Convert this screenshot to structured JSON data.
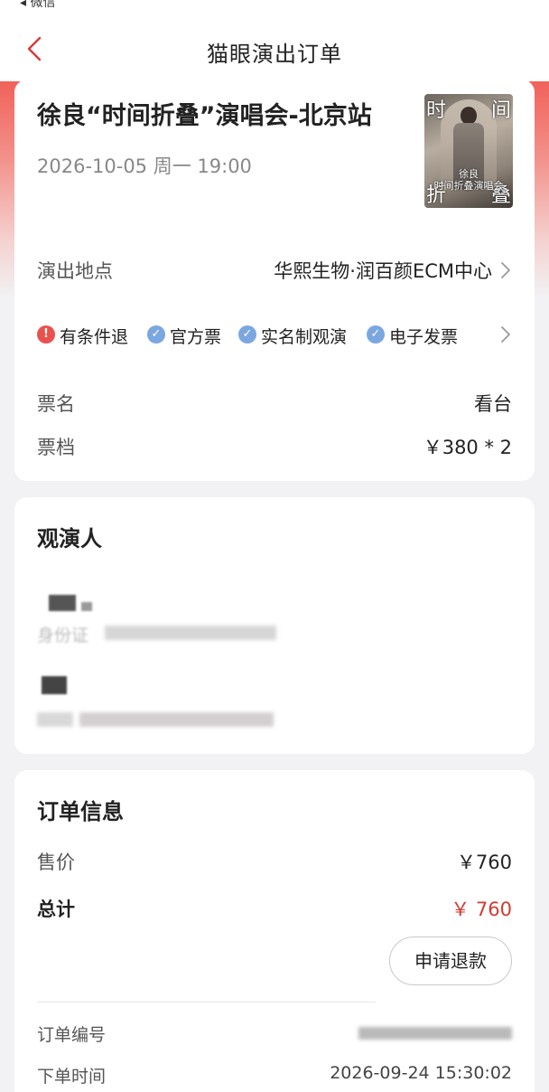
{
  "status_bar": {
    "text": "◂ 微信"
  },
  "nav": {
    "title": "猫眼演出订单"
  },
  "show": {
    "title": "徐良“时间折叠”演唱会-北京站",
    "datetime": "2026-10-05 周一 19:00",
    "poster": {
      "tl": "时",
      "tr": "间",
      "bl": "折",
      "br": "叠",
      "mid_line1": "徐良",
      "mid_line2": "时间折叠演唱会"
    },
    "venue_label": "演出地点",
    "venue_value": "华熙生物·润百颜ECM中心",
    "tags": [
      {
        "icon": "warning-icon",
        "label": "有条件退"
      },
      {
        "icon": "check-icon",
        "label": "官方票"
      },
      {
        "icon": "check-icon",
        "label": "实名制观演"
      },
      {
        "icon": "check-icon",
        "label": "电子发票"
      }
    ],
    "ticket_name_label": "票名",
    "ticket_name_value": "看台",
    "ticket_tier_label": "票档",
    "ticket_tier_value": "￥380 * 2"
  },
  "attendees": {
    "title": "观演人",
    "id_label": "身份证"
  },
  "order": {
    "title": "订单信息",
    "price_label": "售价",
    "price_value": "￥760",
    "total_label": "总计",
    "total_value": "￥ 760",
    "refund_button": "申请退款",
    "order_no_label": "订单编号",
    "order_time_label": "下单时间",
    "order_time_value": "2026-09-24 15:30:02"
  },
  "colors": {
    "accent_red": "#d23b2f",
    "header_gradient_top": "#f0625a",
    "check_blue": "#7ba7e0",
    "warn_red": "#e9524c"
  }
}
